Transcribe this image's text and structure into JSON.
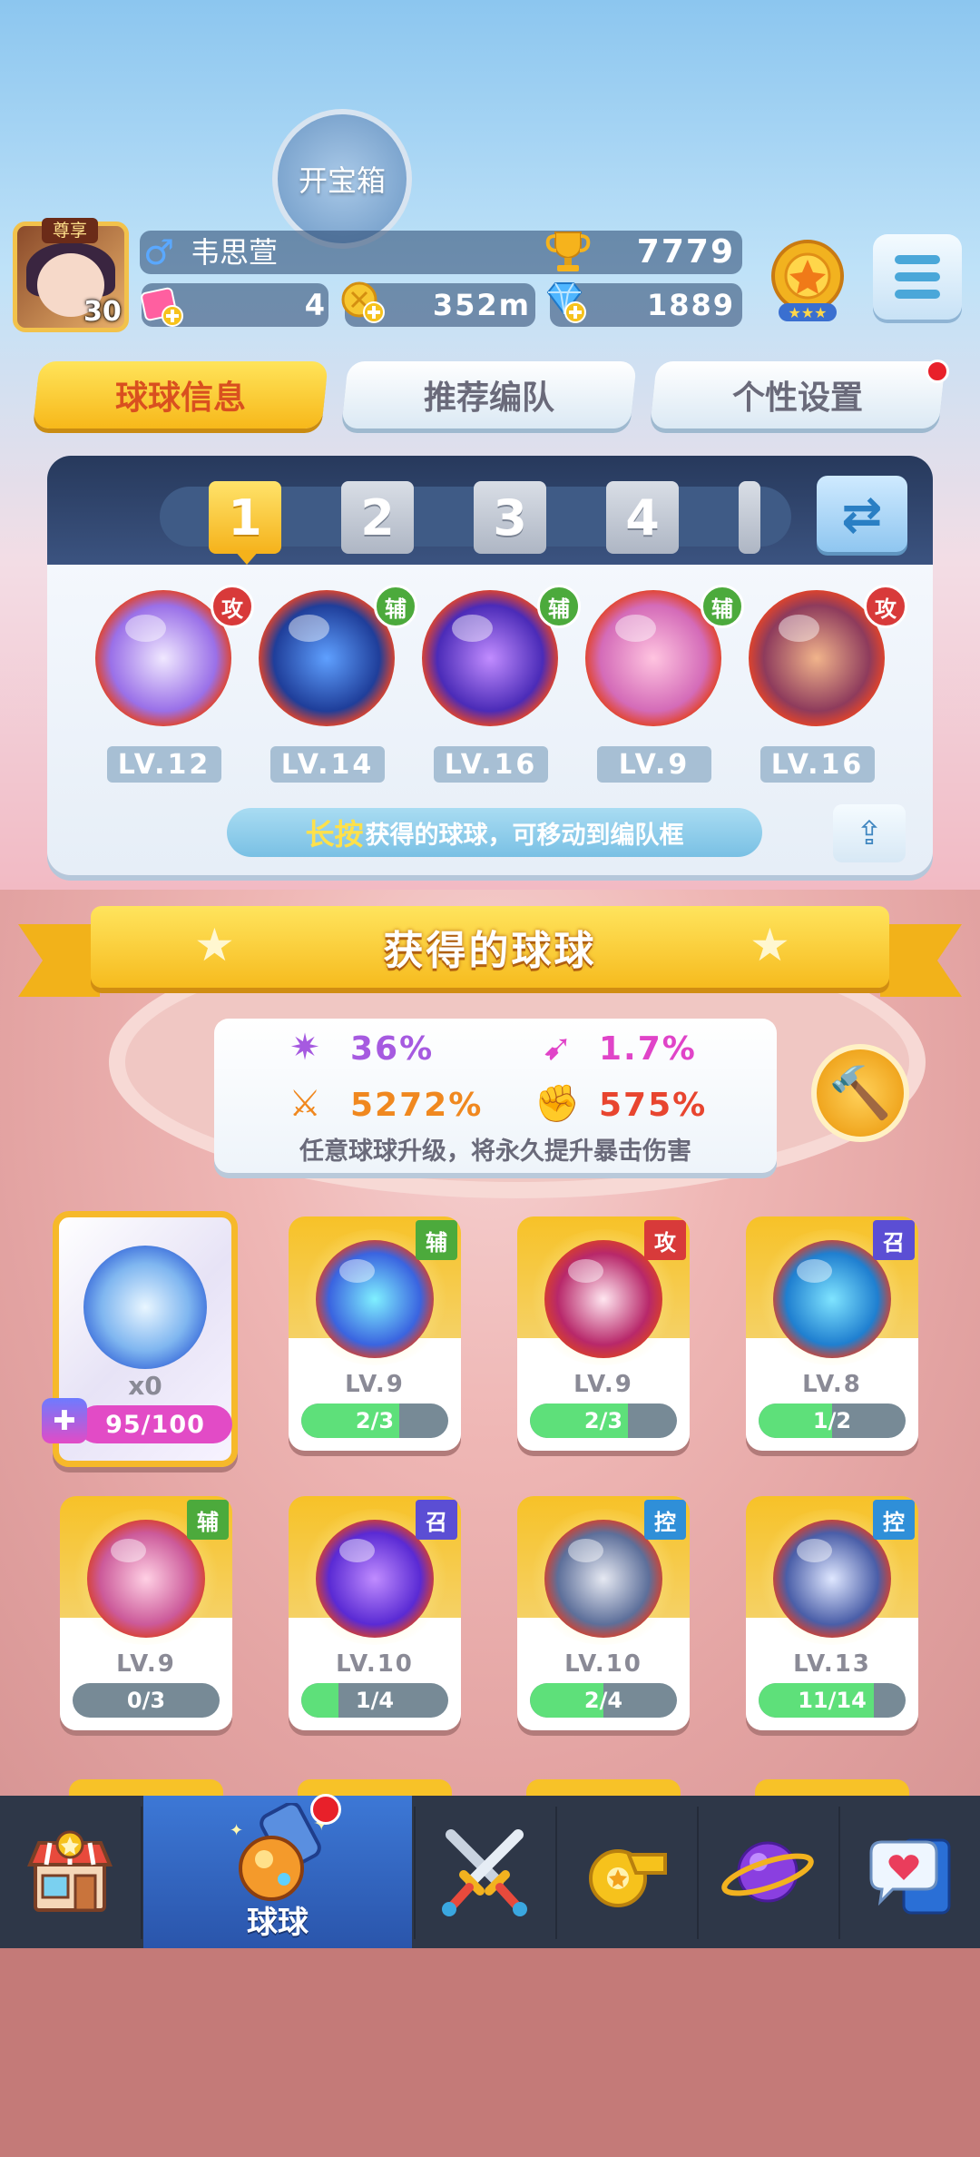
{
  "header": {
    "chest_button": "开宝箱",
    "vip_tag": "尊享",
    "player_level": "30",
    "gender_icon": "male-icon",
    "player_name": "韦思萱",
    "trophies": "7779",
    "tickets": "4",
    "coins": "352m",
    "gems": "1889"
  },
  "tabs": [
    {
      "label": "球球信息",
      "active": true
    },
    {
      "label": "推荐编队",
      "active": false
    },
    {
      "label": "个性设置",
      "active": false,
      "badge": true
    }
  ],
  "lineup": {
    "slots": [
      "1",
      "2",
      "3",
      "4"
    ],
    "active_slot": "1",
    "balls": [
      {
        "role": "攻",
        "level": "LV.12",
        "colors": [
          "#f0e8ff",
          "#9a70e8"
        ]
      },
      {
        "role": "辅",
        "level": "LV.14",
        "colors": [
          "#5fa0ff",
          "#1f3e9a"
        ]
      },
      {
        "role": "辅",
        "level": "LV.16",
        "colors": [
          "#c18cff",
          "#4b2bb8"
        ]
      },
      {
        "role": "辅",
        "level": "LV.9",
        "colors": [
          "#ffc4e0",
          "#d46bb8"
        ]
      },
      {
        "role": "攻",
        "level": "LV.16",
        "colors": [
          "#f1b48b",
          "#8e3b5c"
        ]
      }
    ],
    "hint_emphasis": "长按",
    "hint_text": "获得的球球，可移动到编队框"
  },
  "collection": {
    "title": "获得的球球",
    "stats": {
      "crit_rate": "36%",
      "speed": "1.7%",
      "crit_damage": "5272%",
      "power": "575%",
      "note": "任意球球升级，将永久提升暴击伤害"
    },
    "special_card": {
      "count": "x0",
      "progress": "95/100"
    },
    "cards": [
      {
        "role": "辅",
        "level": "LV.9",
        "progress": "2/3",
        "fill": 0.667,
        "colors": [
          "#7ff0ff",
          "#3a64e0"
        ]
      },
      {
        "role": "攻",
        "level": "LV.9",
        "progress": "2/3",
        "fill": 0.667,
        "colors": [
          "#ffe6f0",
          "#b8286a"
        ]
      },
      {
        "role": "召",
        "level": "LV.8",
        "progress": "1/2",
        "fill": 0.5,
        "colors": [
          "#7fe4ff",
          "#1f7fd0"
        ]
      },
      {
        "role": "辅",
        "level": "LV.9",
        "progress": "0/3",
        "fill": 0,
        "colors": [
          "#ffd0e4",
          "#cc5a9a"
        ]
      },
      {
        "role": "召",
        "level": "LV.10",
        "progress": "1/4",
        "fill": 0.25,
        "colors": [
          "#c08cff",
          "#5a2ad4"
        ]
      },
      {
        "role": "控",
        "level": "LV.10",
        "progress": "2/4",
        "fill": 0.5,
        "colors": [
          "#e6e9f2",
          "#5d6f9a"
        ]
      },
      {
        "role": "控",
        "level": "LV.13",
        "progress": "11/14",
        "fill": 0.786,
        "colors": [
          "#dfe7ff",
          "#4a5ea8"
        ]
      }
    ]
  },
  "nav": {
    "items": [
      {
        "id": "shop",
        "icon": "shop-icon"
      },
      {
        "id": "balls",
        "icon": "ball-bag-icon",
        "label": "球球",
        "active": true,
        "badge": true
      },
      {
        "id": "battle",
        "icon": "crossed-swords-icon"
      },
      {
        "id": "whistle",
        "icon": "whistle-icon"
      },
      {
        "id": "planet",
        "icon": "planet-icon"
      },
      {
        "id": "social",
        "icon": "chat-heart-icon"
      }
    ]
  }
}
